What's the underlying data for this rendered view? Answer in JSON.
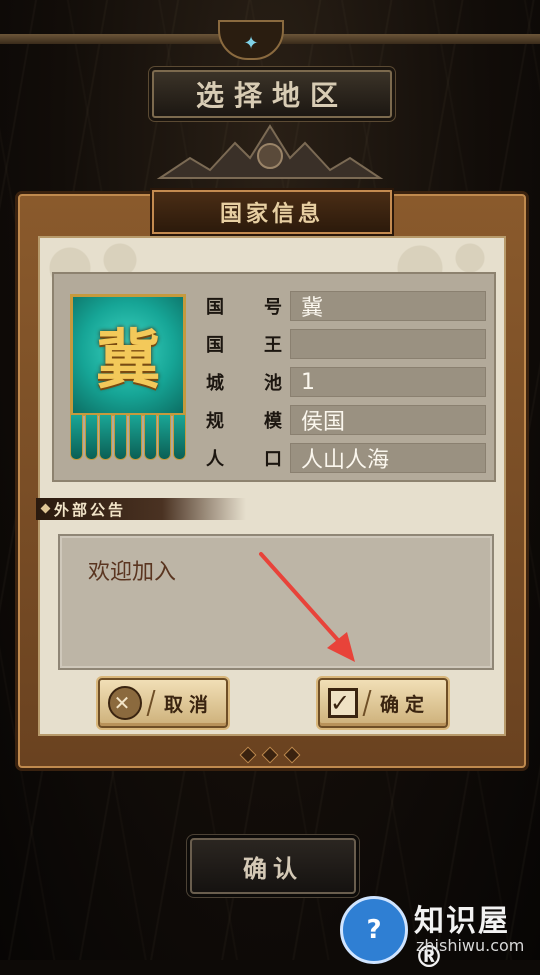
{
  "screen": {
    "title": "选择地区"
  },
  "dialog": {
    "title": "国家信息",
    "banner_char": "冀",
    "fields": [
      {
        "label": [
          "国",
          "号"
        ],
        "value": "冀"
      },
      {
        "label": [
          "国",
          "王"
        ],
        "value": ""
      },
      {
        "label": [
          "城",
          "池"
        ],
        "value": "1"
      },
      {
        "label": [
          "规",
          "模"
        ],
        "value": "侯国"
      },
      {
        "label": [
          "人",
          "口"
        ],
        "value": "人山人海"
      }
    ],
    "notice_title": "外部公告",
    "notice_text": "欢迎加入",
    "cancel_label": "取消",
    "ok_label": "确定"
  },
  "footer": {
    "confirm_label": "确认"
  },
  "watermark": {
    "badge": "?",
    "title": "知识屋®",
    "sub": "zhishiwu.com"
  },
  "colors": {
    "panel_wood": "#8a5a2c",
    "parchment": "#e6dfcd",
    "arrow": "#e8433a",
    "banner_teal": "#16a596"
  },
  "icons": {
    "cancel": "close-circle-icon",
    "ok": "checkbox-check-icon"
  }
}
